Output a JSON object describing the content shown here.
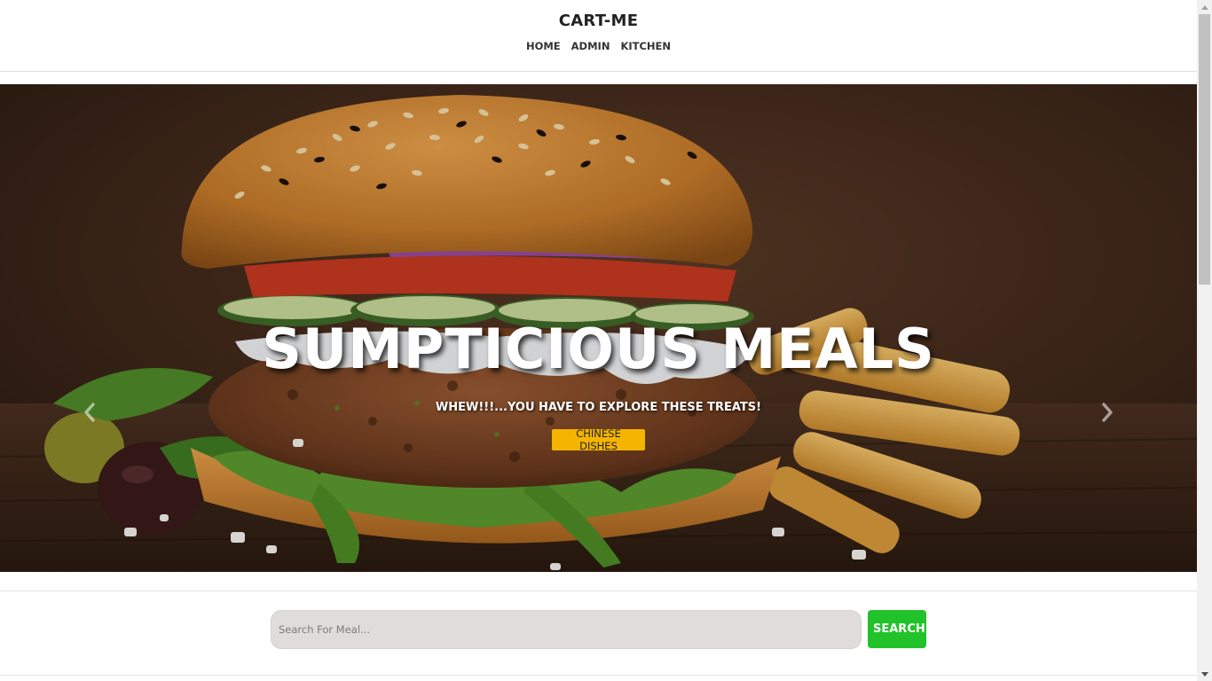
{
  "header": {
    "brand": "CART-ME",
    "nav": [
      {
        "label": "HOME"
      },
      {
        "label": "ADMIN"
      },
      {
        "label": "KITCHEN"
      }
    ]
  },
  "hero": {
    "title": "SUMPTICIOUS MEALS",
    "subtitle": "WHEW!!!...YOU HAVE TO EXPLORE THESE TREATS!",
    "cta_label": "CHINESE DISHES",
    "prev_icon": "chevron-left-icon",
    "next_icon": "chevron-right-icon",
    "image": "burger-with-fries-photo"
  },
  "search": {
    "placeholder": "Search For Meal...",
    "value": "",
    "button_label": "SEARCH"
  },
  "colors": {
    "accent_yellow": "#f5b400",
    "search_green": "#22c22a",
    "search_field_bg": "#e1dcdc"
  }
}
